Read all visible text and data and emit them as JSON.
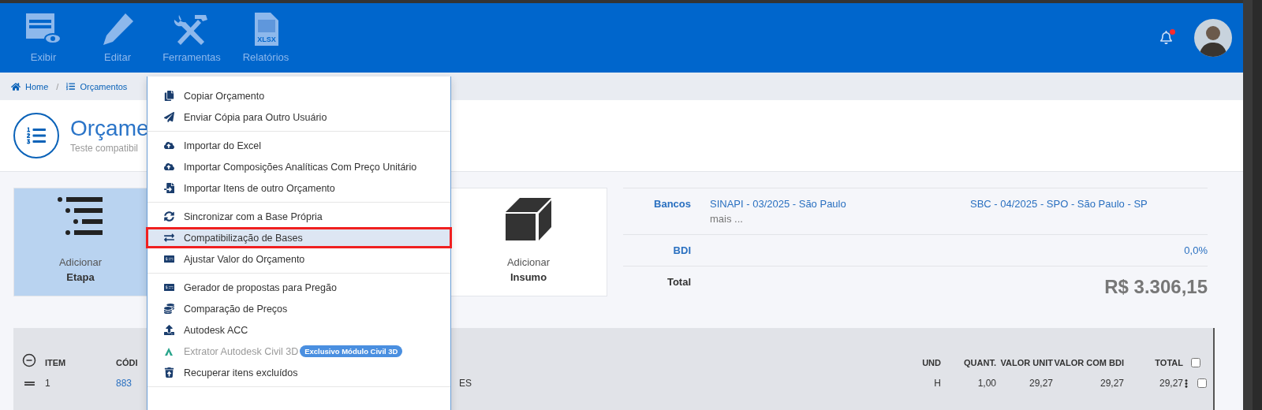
{
  "toolbar": {
    "items": [
      {
        "label": "Exibir"
      },
      {
        "label": "Editar"
      },
      {
        "label": "Ferramentas"
      },
      {
        "label": "Relatórios",
        "badge": "XLSX"
      }
    ]
  },
  "notifications": {
    "unread": true
  },
  "breadcrumb": {
    "items": [
      "Home",
      "Orçamentos"
    ],
    "separator": "/"
  },
  "header": {
    "title": "Orçame",
    "subtitle": "Teste compatibil"
  },
  "cards": [
    {
      "line1": "Adicionar",
      "line2": "Etapa",
      "selected": true
    },
    {
      "line1": "Adicionar",
      "line2": "Insumo",
      "selected": false
    }
  ],
  "summary": {
    "banks_label": "Bancos",
    "banks": [
      "SINAPI - 03/2025 - São Paulo",
      "SBC - 04/2025 - SPO - São Paulo - SP"
    ],
    "more": "mais ...",
    "bdi_label": "BDI",
    "bdi": "0,0%",
    "total_label": "Total",
    "total": "R$ 3.306,15"
  },
  "table": {
    "columns": [
      "ITEM",
      "CÓDI",
      "UND",
      "QUANT.",
      "VALOR UNIT",
      "VALOR COM BDI",
      "TOTAL"
    ],
    "header_checked": false,
    "rows": [
      {
        "item": "1",
        "code": "883",
        "description": "ES",
        "unit": "H",
        "quantity": "1,00",
        "unit_value": "29,27",
        "value_bdi": "29,27",
        "total": "29,27",
        "checked": false
      }
    ]
  },
  "menu": {
    "groups": [
      [
        {
          "label": "Copiar Orçamento",
          "selected": false,
          "disabled": false
        },
        {
          "label": "Enviar Cópia para Outro Usuário",
          "selected": false,
          "disabled": false
        }
      ],
      [
        {
          "label": "Importar do Excel",
          "selected": false,
          "disabled": false
        },
        {
          "label": "Importar Composições Analíticas Com Preço Unitário",
          "selected": false,
          "disabled": false
        },
        {
          "label": "Importar Itens de outro Orçamento",
          "selected": false,
          "disabled": false
        }
      ],
      [
        {
          "label": "Sincronizar com a Base Própria",
          "selected": false,
          "disabled": false
        },
        {
          "label": "Compatibilização de Bases",
          "selected": true,
          "disabled": false
        },
        {
          "label": "Ajustar Valor do Orçamento",
          "selected": false,
          "disabled": false
        }
      ],
      [
        {
          "label": "Gerador de propostas para Pregão",
          "selected": false,
          "disabled": false
        },
        {
          "label": "Comparação de Preços",
          "selected": false,
          "disabled": false
        },
        {
          "label": "Autodesk ACC",
          "selected": false,
          "disabled": false
        },
        {
          "label": "Extrator Autodesk Civil 3D",
          "selected": false,
          "disabled": true,
          "badge": "Exclusivo Módulo Civil 3D"
        },
        {
          "label": "Recuperar itens excluídos",
          "selected": false,
          "disabled": false
        }
      ]
    ]
  }
}
